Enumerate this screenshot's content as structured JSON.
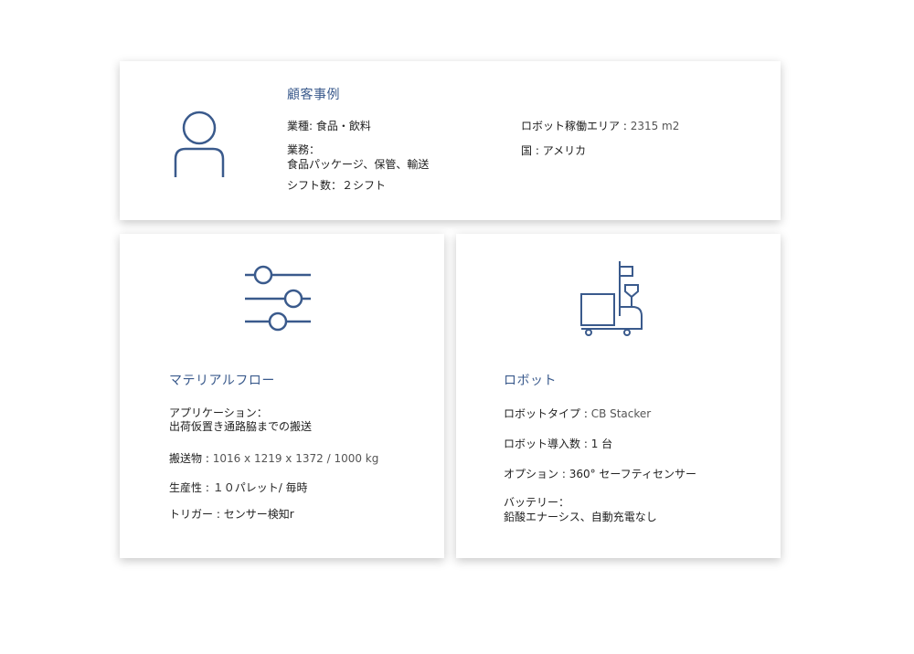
{
  "customer": {
    "title": "顧客事例",
    "industry_label": "業種: ",
    "industry_value": "食品・飲料",
    "work_label": "業務：",
    "work_value": "食品パッケージ、保管、輸送",
    "shifts_label": "シフト数：",
    "shifts_value": "２シフト",
    "area_label": "ロボット稼働エリア : ",
    "area_value": "2315 m2",
    "country_label": "国 : ",
    "country_value": "アメリカ",
    "icon": "user-icon",
    "accent_color": "#3a5a8c"
  },
  "material_flow": {
    "title": "マテリアルフロー",
    "application_label": "アプリケーション：",
    "application_value": "出荷仮置き通路脇までの搬送",
    "load_label": "搬送物 : ",
    "load_value": "1016 x 1219 x 1372 / 1000 kg",
    "productivity_label": "生産性 : ",
    "productivity_value": "１０パレット/ 毎時",
    "trigger_label": "トリガー : ",
    "trigger_value": "センサー検知r",
    "icon": "sliders-icon"
  },
  "robot": {
    "title": "ロボット",
    "type_label": "ロボットタイプ : ",
    "type_value": "CB Stacker",
    "count_label": "ロボット導入数 : ",
    "count_value": "1 台",
    "option_label": "オプション : ",
    "option_value": "360° セーフティセンサー",
    "battery_label": "バッテリー：",
    "battery_value": "鉛酸エナーシス、自動充電なし",
    "icon": "forklift-icon"
  }
}
